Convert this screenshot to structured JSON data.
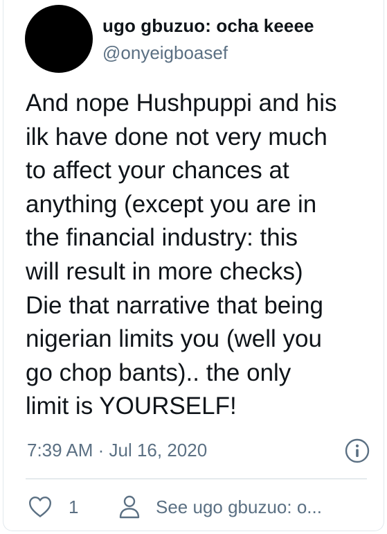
{
  "author": {
    "display_name": "ugo gbuzuo: ocha keeee",
    "handle": "@onyeigboasef"
  },
  "tweet": {
    "lines": [
      "And nope Hushpuppi and his",
      "ilk have done not very much",
      "to affect your chances at",
      "anything (except you are in",
      "the financial industry: this",
      "will result in more checks)",
      "Die that narrative that being",
      "nigerian limits you (well you",
      "go chop bants).. the only",
      "limit is YOURSELF!"
    ],
    "timestamp": "7:39 AM · Jul 16, 2020"
  },
  "actions": {
    "like_count": "1",
    "profile_link_label": "See ugo gbuzuo: o..."
  },
  "icons": {
    "avatar": "avatar-black-circle",
    "info": "info-icon",
    "like": "heart-icon",
    "profile": "person-icon"
  },
  "colors": {
    "primary_text": "#0f1419",
    "secondary_text": "#5b7083",
    "border": "#e1e8ed",
    "avatar": "#000000"
  }
}
